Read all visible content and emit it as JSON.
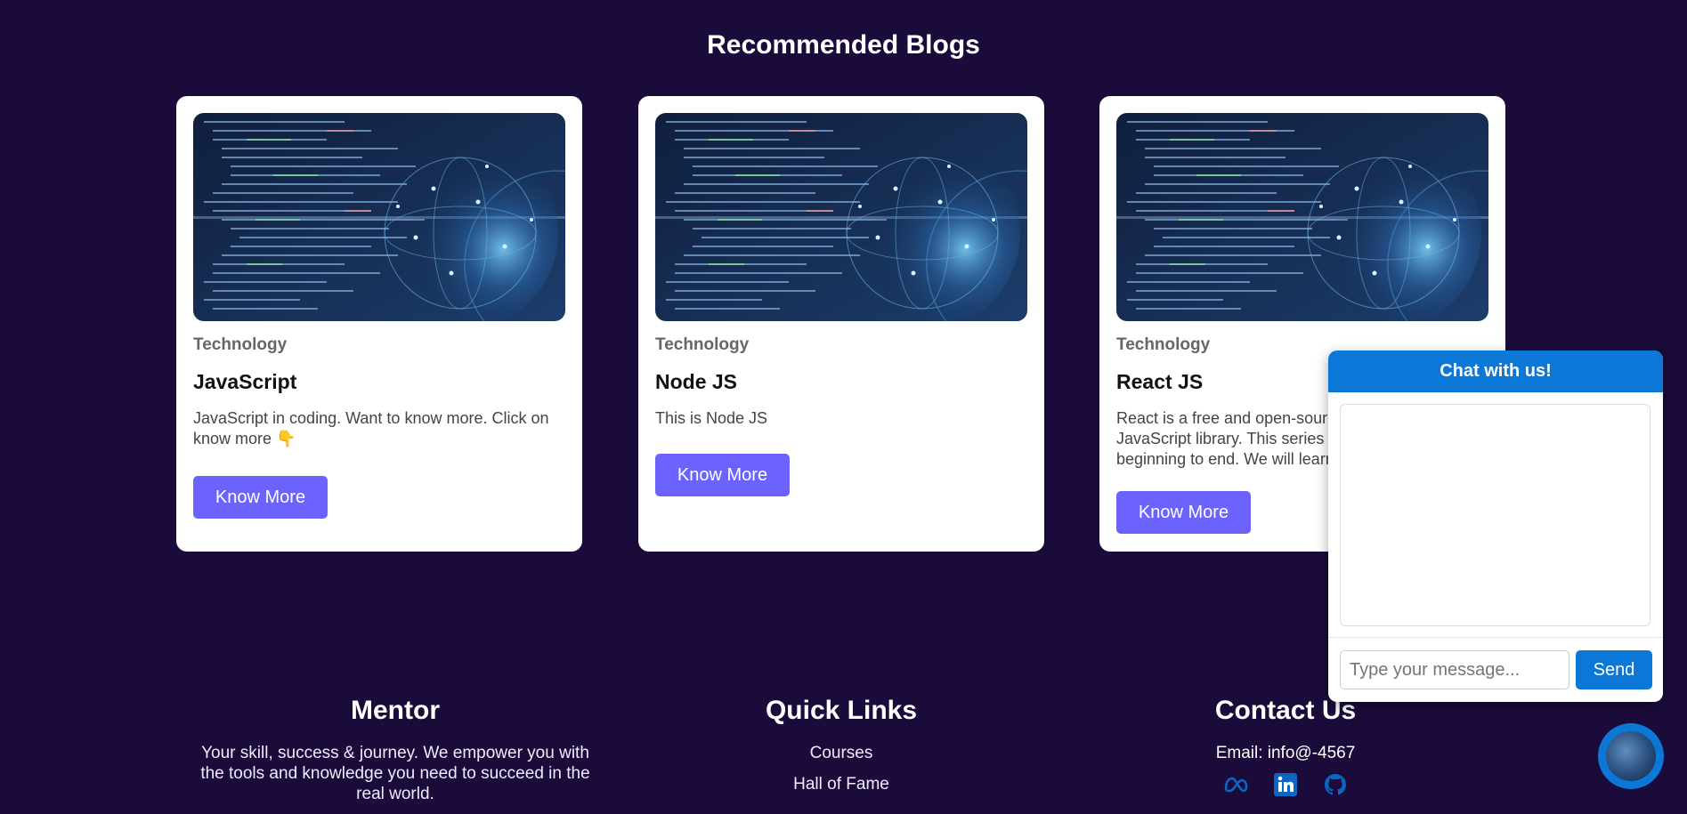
{
  "section": {
    "title": "Recommended Blogs"
  },
  "blogs": [
    {
      "category": "Technology",
      "title": "JavaScript",
      "description": "JavaScript in coding. Want to know more. Click on know more 👇",
      "button_label": "Know More",
      "image_icon": "code-globe-image"
    },
    {
      "category": "Technology",
      "title": "Node JS",
      "description": "This is Node JS",
      "button_label": "Know More",
      "image_icon": "code-globe-image"
    },
    {
      "category": "Technology",
      "title": "React JS",
      "description": "React is a free and open-source front-end JavaScript library. This series will cover React from beginning to end. We will learn react from the",
      "button_label": "Know More",
      "image_icon": "code-globe-image"
    }
  ],
  "footer": {
    "mentor": {
      "heading": "Mentor",
      "text": "Your skill, success & journey. We empower you with the tools and knowledge you need to succeed in the real world."
    },
    "quick_links": {
      "heading": "Quick Links",
      "items": [
        "Courses",
        "Hall of Fame"
      ]
    },
    "contact": {
      "heading": "Contact Us",
      "email": "Email: info@-4567",
      "socials": [
        "meta-icon",
        "linkedin-icon",
        "github-icon"
      ]
    }
  },
  "chat": {
    "header": "Chat with us!",
    "input_placeholder": "Type your message...",
    "send_label": "Send"
  },
  "colors": {
    "background": "#1a0b3b",
    "card": "#ffffff",
    "button": "#6c63ff",
    "chat_accent": "#0b78d8",
    "social_icon": "#0a66c2"
  }
}
